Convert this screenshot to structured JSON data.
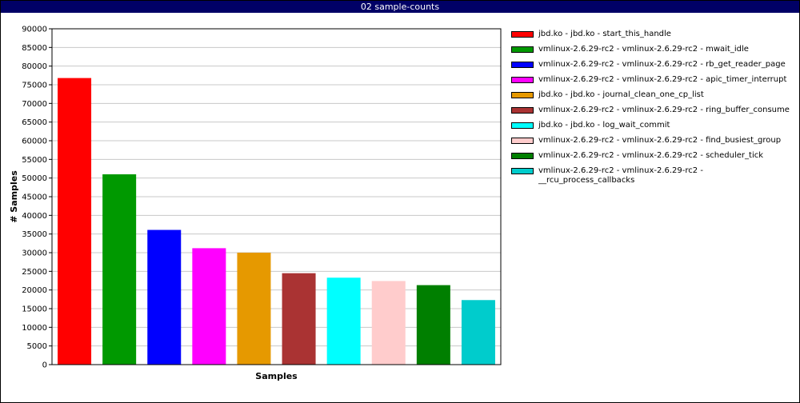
{
  "window": {
    "title": "02 sample-counts"
  },
  "chart_data": {
    "type": "bar",
    "title": "02 sample-counts",
    "xlabel": "Samples",
    "ylabel": "# Samples",
    "ylim": [
      0,
      90000
    ],
    "yticks": [
      0,
      5000,
      10000,
      15000,
      20000,
      25000,
      30000,
      35000,
      40000,
      45000,
      50000,
      55000,
      60000,
      65000,
      70000,
      75000,
      80000,
      85000,
      90000
    ],
    "grid": true,
    "legend_position": "right",
    "categories": [
      "jbd.ko - jbd.ko - start_this_handle",
      "vmlinux-2.6.29-rc2 - vmlinux-2.6.29-rc2 - mwait_idle",
      "vmlinux-2.6.29-rc2 - vmlinux-2.6.29-rc2 - rb_get_reader_page",
      "vmlinux-2.6.29-rc2 - vmlinux-2.6.29-rc2 - apic_timer_interrupt",
      "jbd.ko - jbd.ko - journal_clean_one_cp_list",
      "vmlinux-2.6.29-rc2 - vmlinux-2.6.29-rc2 - ring_buffer_consume",
      "jbd.ko - jbd.ko - log_wait_commit",
      "vmlinux-2.6.29-rc2 - vmlinux-2.6.29-rc2 - find_busiest_group",
      "vmlinux-2.6.29-rc2 - vmlinux-2.6.29-rc2 - scheduler_tick",
      "vmlinux-2.6.29-rc2 - vmlinux-2.6.29-rc2 - __rcu_process_callbacks"
    ],
    "values": [
      76800,
      51000,
      36100,
      31200,
      30000,
      24500,
      23300,
      22400,
      21300,
      17300
    ],
    "colors": [
      "#ff0000",
      "#009900",
      "#0000ff",
      "#ff00ff",
      "#e69900",
      "#aa3333",
      "#00ffff",
      "#ffcccc",
      "#007f00",
      "#00cccc"
    ]
  }
}
